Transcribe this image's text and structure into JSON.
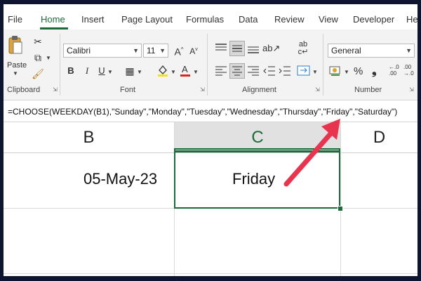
{
  "tabs": [
    {
      "label": "File",
      "active": false
    },
    {
      "label": "Home",
      "active": true
    },
    {
      "label": "Insert",
      "active": false
    },
    {
      "label": "Page Layout",
      "active": false
    },
    {
      "label": "Formulas",
      "active": false
    },
    {
      "label": "Data",
      "active": false
    },
    {
      "label": "Review",
      "active": false
    },
    {
      "label": "View",
      "active": false
    },
    {
      "label": "Developer",
      "active": false
    },
    {
      "label": "Hel",
      "active": false
    }
  ],
  "ribbon": {
    "clipboard": {
      "label": "Clipboard",
      "paste_label": "Paste"
    },
    "font": {
      "label": "Font",
      "font_name": "Calibri",
      "font_size": "11"
    },
    "alignment": {
      "label": "Alignment"
    },
    "number": {
      "label": "Number",
      "format": "General"
    }
  },
  "formula_bar": {
    "formula": "=CHOOSE(WEEKDAY(B1),\"Sunday\",\"Monday\",\"Tuesday\",\"Wednesday\",\"Thursday\",\"Friday\",\"Saturday\")"
  },
  "grid": {
    "columns": [
      "B",
      "C",
      "D"
    ],
    "selected_column": "C",
    "cells": {
      "B1": "05-May-23",
      "C1": "Friday"
    }
  },
  "colors": {
    "accent": "#1d6b3a",
    "arrow": "#e8344e"
  }
}
